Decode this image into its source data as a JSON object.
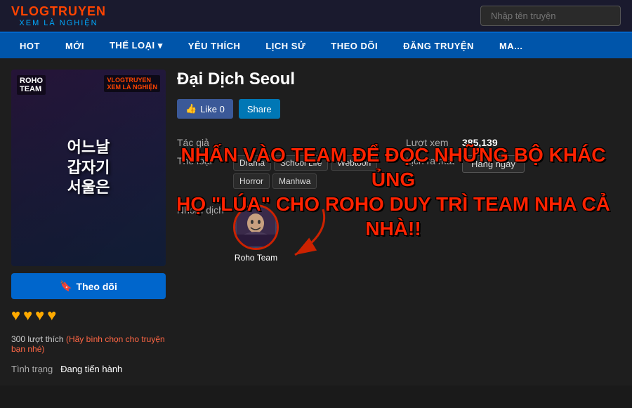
{
  "header": {
    "logo_top": "VLOGTRUYEN",
    "logo_bottom": "XEM LÀ NGHIỆN",
    "search_placeholder": "Nhập tên truyện"
  },
  "nav": {
    "items": [
      {
        "label": "HOT"
      },
      {
        "label": "MỚI"
      },
      {
        "label": "THỂ LOẠI ▾"
      },
      {
        "label": "YÊU THÍCH"
      },
      {
        "label": "LỊCH SỬ"
      },
      {
        "label": "THEO DÕI"
      },
      {
        "label": "ĐĂNG TRUYỆN"
      },
      {
        "label": "MA..."
      }
    ]
  },
  "manga": {
    "title": "Đại Dịch Seoul",
    "cover_label": "ROHO\nTEAM",
    "cover_title_line1": "어느날",
    "cover_title_line2": "갑자기",
    "cover_title_line3": "서울은",
    "like_label": "Like 0",
    "share_label": "Share",
    "overlay_line1": "NHẤN VÀO TEAM ĐỂ ĐỌC NHỮNG BỘ KHÁC ỦNG",
    "overlay_line2": "HỌ \"LÚA\" CHO ROHO DUY TRÌ TEAM NHA CẢ NHÀ!!",
    "tac_gia_label": "Tác giả",
    "tac_gia_value": "",
    "luot_xem_label": "Lượt xem",
    "luot_xem_value": "385,139",
    "the_loai_label": "Thể loại",
    "tags": [
      "Drama",
      "School Life",
      "Webtoon",
      "Horror",
      "Manhwa"
    ],
    "nhom_dich_label": "Nhóm dịch",
    "lich_ra_mat_label": "Lịch ra mắt",
    "lich_ra_mat_value": "Hàng ngày",
    "team_name": "Roho Team",
    "follow_label": "Theo dõi",
    "stars_count": 4,
    "rating_count": "300 lượt thích",
    "rating_cta": "(Hãy bình chọn cho truyện bạn nhé)",
    "tinh_trang_label": "Tình trạng",
    "tinh_trang_value": "Đang tiến hành"
  }
}
